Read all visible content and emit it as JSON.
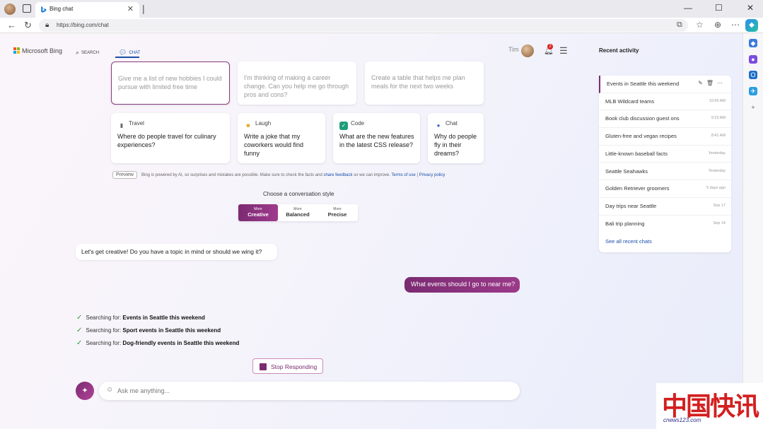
{
  "browser": {
    "tab_title": "Bing chat",
    "tab_close": "✕",
    "tab_new": "|",
    "url": "https://bing.com/chat",
    "win_minimize": "—",
    "win_maximize": "☐",
    "win_close": "✕"
  },
  "header": {
    "logo_text": "Microsoft Bing",
    "nav_search": "SEARCH",
    "nav_chat": "CHAT",
    "user_name": "Tim",
    "notification_count": "2"
  },
  "top_cards": [
    {
      "text": "Give me a list of new hobbies I could pursue with limited free time"
    },
    {
      "text": "I'm thinking of making a career change. Can you help me go through pros and cons?"
    },
    {
      "text": "Create a table that helps me plan meals for the next two weeks"
    }
  ],
  "cards": [
    {
      "category": "Travel",
      "text": "Where do people travel for culinary experiences?",
      "color": "#6b6b6b"
    },
    {
      "category": "Laugh",
      "text": "Write a joke that my coworkers would find funny",
      "color": "#e6a21a"
    },
    {
      "category": "Code",
      "text": "What are the new features in the latest CSS release?",
      "color": "#1f9d7a"
    },
    {
      "category": "Chat",
      "text": "Why do people fly in their dreams?",
      "color": "#3b62d6"
    }
  ],
  "disclaimer": {
    "badge": "Preview",
    "text": "Bing is powered by AI, so surprises and mistakes are possible. Make sure to check the facts and ",
    "share_feedback": "share feedback",
    "text2": " so we can improve. ",
    "terms": "Terms of use",
    "sep": " | ",
    "privacy": "Privacy policy"
  },
  "conversation_style": {
    "label": "Choose a conversation style",
    "options": [
      {
        "more": "More",
        "name": "Creative"
      },
      {
        "more": "More",
        "name": "Balanced"
      },
      {
        "more": "More",
        "name": "Precise"
      }
    ],
    "selected": "Creative"
  },
  "messages": {
    "bot": "Let's get creative! Do you have a topic in mind or should we wing it?",
    "user": "What events should I go to near me?"
  },
  "searches": [
    {
      "prefix": "Searching for: ",
      "query": "Events in Seattle this weekend"
    },
    {
      "prefix": "Searching for: ",
      "query": "Sport events in Seattle this weekend"
    },
    {
      "prefix": "Searching for: ",
      "query": "Dog-friendly events in Seattle this weekend"
    }
  ],
  "stop_button": "Stop Responding",
  "ask": {
    "placeholder": "Ask me anything..."
  },
  "recent": {
    "title": "Recent activity",
    "items": [
      {
        "name": "Events in Seattle this weekend",
        "time": ""
      },
      {
        "name": "MLB Wildcard teams",
        "time": "10:06 AM"
      },
      {
        "name": "Book club discussion guest ons",
        "time": "9:23 AM"
      },
      {
        "name": "Gluten-free and vegan recipes",
        "time": "8:41 AM"
      },
      {
        "name": "Little-known baseball facts",
        "time": "Yesterday"
      },
      {
        "name": "Seattle Seahawks",
        "time": "Yesterday"
      },
      {
        "name": "Golden Retriever groomers",
        "time": "5 days ago"
      },
      {
        "name": "Day trips near Seattle",
        "time": "Sep 17"
      },
      {
        "name": "Bali trip planning",
        "time": "Sep 14"
      }
    ],
    "see_all": "See all recent chats"
  },
  "watermark": {
    "text": "中国快讯",
    "sub": "cnews123.com"
  },
  "colors": {
    "accent": "#7b2b72",
    "link": "#1a4fa8",
    "check": "#2a9d3a"
  }
}
